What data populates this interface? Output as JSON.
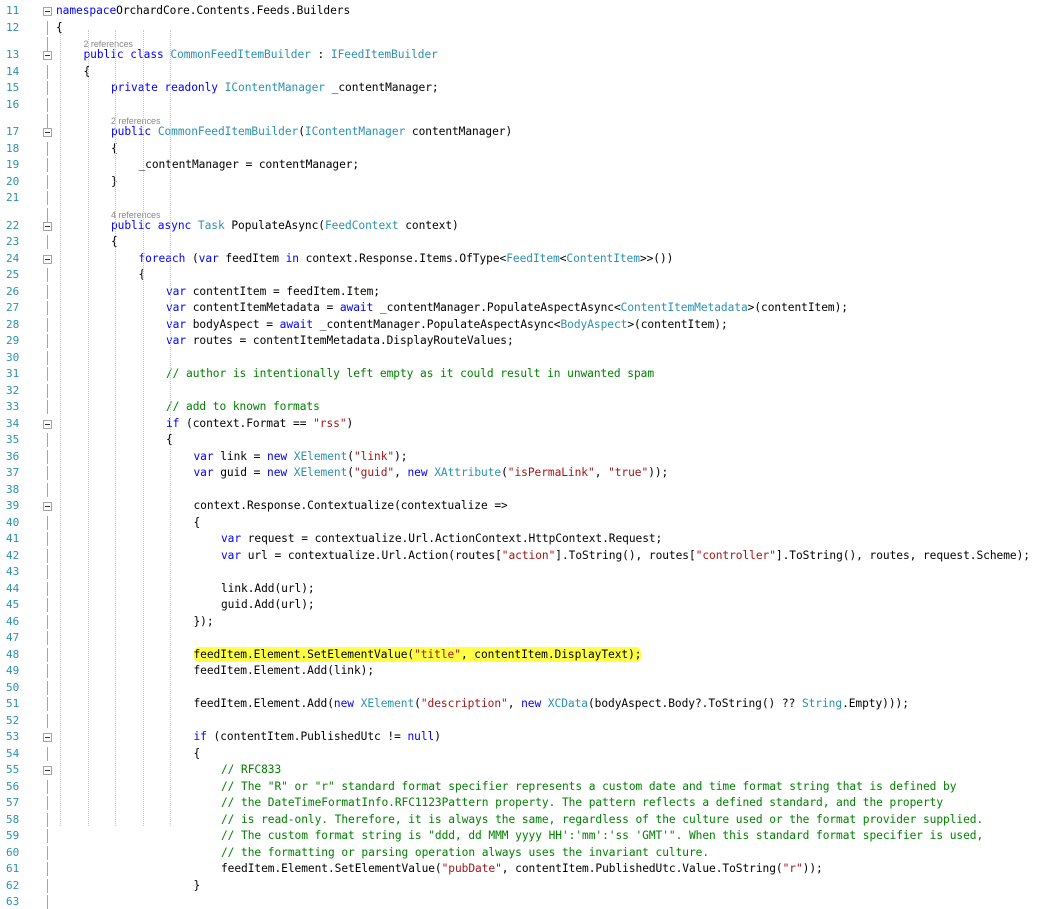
{
  "editor": {
    "highlight_color": "#ffff45",
    "lines": [
      {
        "n": "11",
        "indent": 0,
        "fold": true,
        "tokens": [
          [
            "k",
            "namespace"
          ],
          [
            "",
            "OrchardCore.Contents.Feeds.Builders"
          ]
        ]
      },
      {
        "n": "12",
        "indent": 0,
        "tokens": [
          [
            "",
            "{"
          ]
        ]
      },
      {
        "n": "",
        "indent": 1,
        "refs": "2 references"
      },
      {
        "n": "13",
        "indent": 1,
        "fold": true,
        "tokens": [
          [
            "k",
            "public class "
          ],
          [
            "t",
            "CommonFeedItemBuilder"
          ],
          [
            "",
            " : "
          ],
          [
            "t",
            "IFeedItemBuilder"
          ]
        ]
      },
      {
        "n": "14",
        "indent": 1,
        "tokens": [
          [
            "",
            "{"
          ]
        ]
      },
      {
        "n": "15",
        "indent": 2,
        "tokens": [
          [
            "k",
            "private readonly "
          ],
          [
            "t",
            "IContentManager"
          ],
          [
            "",
            " _contentManager;"
          ]
        ]
      },
      {
        "n": "16",
        "indent": 0,
        "tokens": []
      },
      {
        "n": "",
        "indent": 2,
        "refs": "2 references"
      },
      {
        "n": "17",
        "indent": 2,
        "fold": true,
        "tokens": [
          [
            "k",
            "public "
          ],
          [
            "t",
            "CommonFeedItemBuilder"
          ],
          [
            "",
            "("
          ],
          [
            "t",
            "IContentManager"
          ],
          [
            "",
            " contentManager)"
          ]
        ]
      },
      {
        "n": "18",
        "indent": 2,
        "tokens": [
          [
            "",
            "{"
          ]
        ]
      },
      {
        "n": "19",
        "indent": 3,
        "tokens": [
          [
            "",
            "_contentManager = contentManager;"
          ]
        ]
      },
      {
        "n": "20",
        "indent": 2,
        "tokens": [
          [
            "",
            "}"
          ]
        ]
      },
      {
        "n": "21",
        "indent": 0,
        "tokens": []
      },
      {
        "n": "",
        "indent": 2,
        "refs": "4 references"
      },
      {
        "n": "22",
        "indent": 2,
        "fold": true,
        "tokens": [
          [
            "k",
            "public async "
          ],
          [
            "t",
            "Task"
          ],
          [
            "",
            " PopulateAsync("
          ],
          [
            "t",
            "FeedContext"
          ],
          [
            "",
            " context)"
          ]
        ]
      },
      {
        "n": "23",
        "indent": 2,
        "tokens": [
          [
            "",
            "{"
          ]
        ]
      },
      {
        "n": "24",
        "indent": 3,
        "fold": true,
        "tokens": [
          [
            "k",
            "foreach "
          ],
          [
            "",
            "("
          ],
          [
            "k",
            "var"
          ],
          [
            "",
            " feedItem "
          ],
          [
            "k",
            "in"
          ],
          [
            "",
            " context.Response.Items.OfType<"
          ],
          [
            "t",
            "FeedItem"
          ],
          [
            "",
            "<"
          ],
          [
            "t",
            "ContentItem"
          ],
          [
            "",
            ">>())"
          ]
        ]
      },
      {
        "n": "25",
        "indent": 3,
        "tokens": [
          [
            "",
            "{"
          ]
        ]
      },
      {
        "n": "26",
        "indent": 4,
        "tokens": [
          [
            "k",
            "var"
          ],
          [
            "",
            " contentItem = feedItem.Item;"
          ]
        ]
      },
      {
        "n": "27",
        "indent": 4,
        "tokens": [
          [
            "k",
            "var"
          ],
          [
            "",
            " contentItemMetadata = "
          ],
          [
            "k",
            "await"
          ],
          [
            "",
            " _contentManager.PopulateAspectAsync<"
          ],
          [
            "t",
            "ContentItemMetadata"
          ],
          [
            "",
            ">(contentItem);"
          ]
        ]
      },
      {
        "n": "28",
        "indent": 4,
        "tokens": [
          [
            "k",
            "var"
          ],
          [
            "",
            " bodyAspect = "
          ],
          [
            "k",
            "await"
          ],
          [
            "",
            " _contentManager.PopulateAspectAsync<"
          ],
          [
            "t",
            "BodyAspect"
          ],
          [
            "",
            ">(contentItem);"
          ]
        ]
      },
      {
        "n": "29",
        "indent": 4,
        "tokens": [
          [
            "k",
            "var"
          ],
          [
            "",
            " routes = contentItemMetadata.DisplayRouteValues;"
          ]
        ]
      },
      {
        "n": "30",
        "indent": 0,
        "tokens": []
      },
      {
        "n": "31",
        "indent": 4,
        "tokens": [
          [
            "c",
            "// author is intentionally left empty as it could result in unwanted spam"
          ]
        ]
      },
      {
        "n": "32",
        "indent": 0,
        "tokens": []
      },
      {
        "n": "33",
        "indent": 4,
        "tokens": [
          [
            "c",
            "// add to known formats"
          ]
        ]
      },
      {
        "n": "34",
        "indent": 4,
        "fold": true,
        "tokens": [
          [
            "k",
            "if"
          ],
          [
            "",
            " (context.Format == "
          ],
          [
            "s",
            "\"rss\""
          ],
          [
            "",
            ")"
          ]
        ]
      },
      {
        "n": "35",
        "indent": 4,
        "tokens": [
          [
            "",
            "{"
          ]
        ]
      },
      {
        "n": "36",
        "indent": 5,
        "tokens": [
          [
            "k",
            "var"
          ],
          [
            "",
            " link = "
          ],
          [
            "k",
            "new "
          ],
          [
            "t",
            "XElement"
          ],
          [
            "",
            "("
          ],
          [
            "s",
            "\"link\""
          ],
          [
            "",
            ");"
          ]
        ]
      },
      {
        "n": "37",
        "indent": 5,
        "tokens": [
          [
            "k",
            "var"
          ],
          [
            "",
            " guid = "
          ],
          [
            "k",
            "new "
          ],
          [
            "t",
            "XElement"
          ],
          [
            "",
            "("
          ],
          [
            "s",
            "\"guid\""
          ],
          [
            "",
            ", "
          ],
          [
            "k",
            "new "
          ],
          [
            "t",
            "XAttribute"
          ],
          [
            "",
            "("
          ],
          [
            "s",
            "\"isPermaLink\""
          ],
          [
            "",
            ", "
          ],
          [
            "s",
            "\"true\""
          ],
          [
            "",
            "));"
          ]
        ]
      },
      {
        "n": "38",
        "indent": 0,
        "tokens": []
      },
      {
        "n": "39",
        "indent": 5,
        "fold": true,
        "tokens": [
          [
            "",
            "context.Response.Contextualize(contextualize =>"
          ]
        ]
      },
      {
        "n": "40",
        "indent": 5,
        "tokens": [
          [
            "",
            "{"
          ]
        ]
      },
      {
        "n": "41",
        "indent": 6,
        "tokens": [
          [
            "k",
            "var"
          ],
          [
            "",
            " request = contextualize.Url.ActionContext.HttpContext.Request;"
          ]
        ]
      },
      {
        "n": "42",
        "indent": 6,
        "tokens": [
          [
            "k",
            "var"
          ],
          [
            "",
            " url = contextualize.Url.Action(routes["
          ],
          [
            "s",
            "\"action\""
          ],
          [
            "",
            "].ToString(), routes["
          ],
          [
            "s",
            "\"controller\""
          ],
          [
            "",
            "].ToString(), routes, request.Scheme);"
          ]
        ]
      },
      {
        "n": "43",
        "indent": 0,
        "tokens": []
      },
      {
        "n": "44",
        "indent": 6,
        "tokens": [
          [
            "",
            "link.Add(url);"
          ]
        ]
      },
      {
        "n": "45",
        "indent": 6,
        "tokens": [
          [
            "",
            "guid.Add(url);"
          ]
        ]
      },
      {
        "n": "46",
        "indent": 5,
        "tokens": [
          [
            "",
            "});"
          ]
        ]
      },
      {
        "n": "47",
        "indent": 0,
        "tokens": []
      },
      {
        "n": "48",
        "indent": 5,
        "highlight": true,
        "tokens": [
          [
            "",
            "feedItem.Element.SetElementValue("
          ],
          [
            "s",
            "\"title\""
          ],
          [
            "",
            ", contentItem.DisplayText);"
          ]
        ]
      },
      {
        "n": "49",
        "indent": 5,
        "tokens": [
          [
            "",
            "feedItem.Element.Add(link);"
          ]
        ]
      },
      {
        "n": "50",
        "indent": 0,
        "tokens": []
      },
      {
        "n": "51",
        "indent": 5,
        "tokens": [
          [
            "",
            "feedItem.Element.Add("
          ],
          [
            "k",
            "new "
          ],
          [
            "t",
            "XElement"
          ],
          [
            "",
            "("
          ],
          [
            "s",
            "\"description\""
          ],
          [
            "",
            ", "
          ],
          [
            "k",
            "new "
          ],
          [
            "t",
            "XCData"
          ],
          [
            "",
            "(bodyAspect.Body?.ToString() ?? "
          ],
          [
            "t",
            "String"
          ],
          [
            "",
            ".Empty)));"
          ]
        ]
      },
      {
        "n": "52",
        "indent": 0,
        "tokens": []
      },
      {
        "n": "53",
        "indent": 5,
        "fold": true,
        "tokens": [
          [
            "k",
            "if"
          ],
          [
            "",
            " (contentItem.PublishedUtc != "
          ],
          [
            "k",
            "null"
          ],
          [
            "",
            ")"
          ]
        ]
      },
      {
        "n": "54",
        "indent": 5,
        "tokens": [
          [
            "",
            "{"
          ]
        ]
      },
      {
        "n": "55",
        "indent": 6,
        "fold": true,
        "tokens": [
          [
            "c",
            "// RFC833"
          ]
        ]
      },
      {
        "n": "56",
        "indent": 6,
        "tokens": [
          [
            "c",
            "// The \"R\" or \"r\" standard format specifier represents a custom date and time format string that is defined by"
          ]
        ]
      },
      {
        "n": "57",
        "indent": 6,
        "tokens": [
          [
            "c",
            "// the DateTimeFormatInfo.RFC1123Pattern property. The pattern reflects a defined standard, and the property"
          ]
        ]
      },
      {
        "n": "58",
        "indent": 6,
        "tokens": [
          [
            "c",
            "// is read-only. Therefore, it is always the same, regardless of the culture used or the format provider supplied."
          ]
        ]
      },
      {
        "n": "59",
        "indent": 6,
        "tokens": [
          [
            "c",
            "// The custom format string is \"ddd, dd MMM yyyy HH':'mm':'ss 'GMT'\". When this standard format specifier is used,"
          ]
        ]
      },
      {
        "n": "60",
        "indent": 6,
        "tokens": [
          [
            "c",
            "// the formatting or parsing operation always uses the invariant culture."
          ]
        ]
      },
      {
        "n": "61",
        "indent": 6,
        "tokens": [
          [
            "",
            "feedItem.Element.SetElementValue("
          ],
          [
            "s",
            "\"pubDate\""
          ],
          [
            "",
            ", contentItem.PublishedUtc.Value.ToString("
          ],
          [
            "s",
            "\"r\""
          ],
          [
            "",
            "));"
          ]
        ]
      },
      {
        "n": "62",
        "indent": 5,
        "tokens": [
          [
            "",
            "}"
          ]
        ]
      },
      {
        "n": "63",
        "indent": 0,
        "tokens": []
      }
    ]
  }
}
